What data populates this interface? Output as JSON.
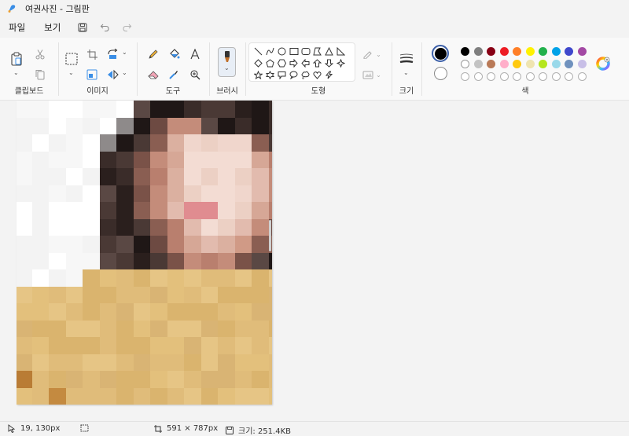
{
  "app": {
    "title": "여권사진 - 그림판"
  },
  "menu": {
    "file_label": "파일",
    "view_label": "보기",
    "save_icon": "save-icon",
    "undo_icon": "undo-icon",
    "redo_icon": "redo-icon"
  },
  "ribbon": {
    "groups": {
      "clipboard": "클립보드",
      "image": "이미지",
      "tools": "도구",
      "brushes": "브러시",
      "shapes": "도형",
      "size": "크기",
      "colors": "색"
    },
    "active_tool": "pencil",
    "primary_color": "#000000",
    "secondary_color": "#ffffff",
    "palette_row1": [
      "#000000",
      "#7f7f7f",
      "#880015",
      "#ed1c24",
      "#ff7f27",
      "#fff200",
      "#22b14c",
      "#00a2e8",
      "#3f48cc",
      "#a349a4"
    ],
    "palette_row2": [
      "#ffffff",
      "#c3c3c3",
      "#b97a57",
      "#ffaec9",
      "#ffc90e",
      "#efe4b0",
      "#b5e61d",
      "#99d9ea",
      "#7092be",
      "#c8bfe7"
    ]
  },
  "status": {
    "cursor_position": "19, 130px",
    "canvas_size": "591 × 787px",
    "file_size": "크기: 251.4KB"
  }
}
